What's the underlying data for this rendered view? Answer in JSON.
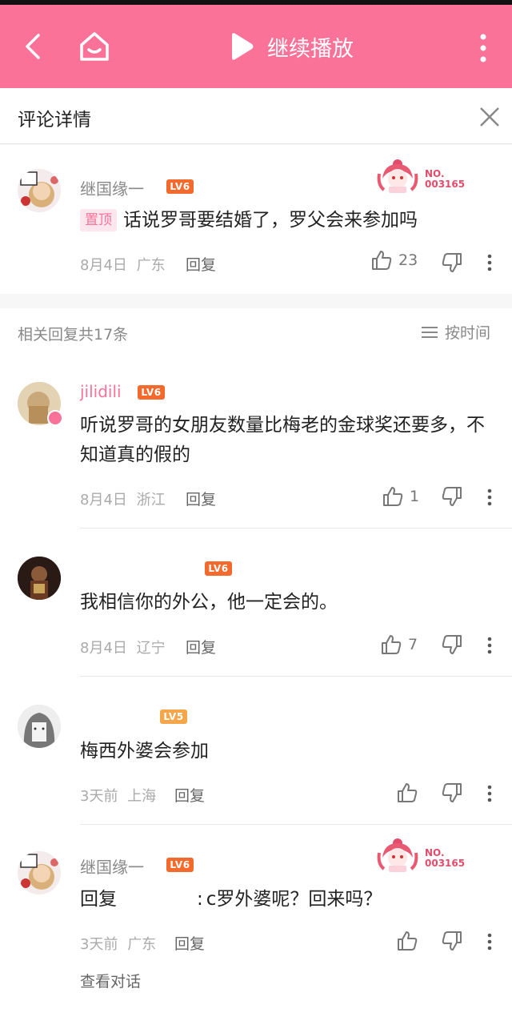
{
  "topbar": {
    "continue_label": "继续播放",
    "accent": "#fb7299"
  },
  "detail": {
    "title": "评论详情"
  },
  "root_comment": {
    "username": "继国缘一",
    "level": "LV6",
    "pinned_label": "置顶",
    "content": "话说罗哥要结婚了，罗父会来参加吗",
    "date": "8月4日",
    "location": "广东",
    "reply_label": "回复",
    "likes": "23",
    "fan_no_label": "NO.",
    "fan_no": "003165"
  },
  "replies_header": {
    "count_text": "相关回复共17条",
    "sort_label": "按时间"
  },
  "replies": [
    {
      "username": "jilidili",
      "level": "LV6",
      "content": "听说罗哥的女朋友数量比梅老的金球奖还要多，不知道真的假的",
      "date": "8月4日",
      "location": "浙江",
      "reply_label": "回复",
      "likes": "1"
    },
    {
      "username": "",
      "level": "LV6",
      "content": "我相信你的外公，他一定会的。",
      "date": "8月4日",
      "location": "辽宁",
      "reply_label": "回复",
      "likes": "7"
    },
    {
      "username": "",
      "level": "LV5",
      "content": "梅西外婆会参加",
      "date": "3天前",
      "location": "上海",
      "reply_label": "回复",
      "likes": ""
    },
    {
      "username": "继国缘一",
      "level": "LV6",
      "content_prefix": "回复",
      "content_suffix": "c罗外婆呢？回来吗？",
      "date": "3天前",
      "location": "广东",
      "reply_label": "回复",
      "likes": "",
      "view_conversation": "查看对话",
      "fan_no_label": "NO.",
      "fan_no": "003165"
    }
  ]
}
